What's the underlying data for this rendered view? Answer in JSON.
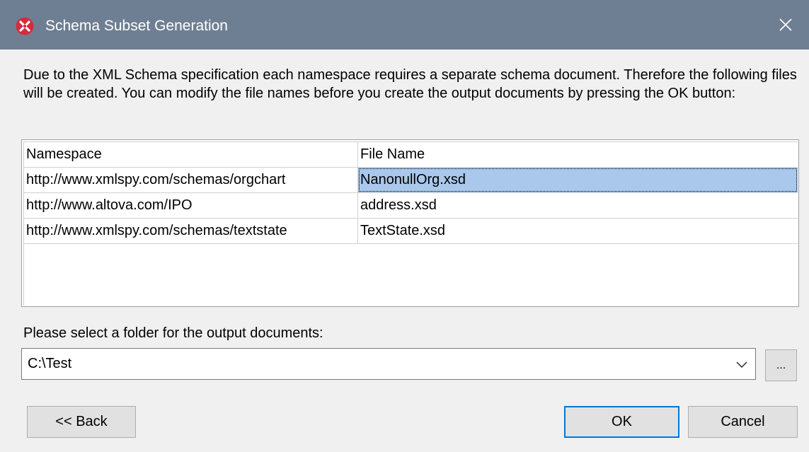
{
  "window": {
    "title": "Schema Subset Generation",
    "close_glyph": "✕"
  },
  "description": "Due to the XML Schema specification each namespace requires a separate schema document. Therefore the following files will be created. You can modify the file names before you create the output documents by pressing the OK button:",
  "grid": {
    "columns": [
      "Namespace",
      "File Name"
    ],
    "rows": [
      {
        "namespace": "http://www.xmlspy.com/schemas/orgchart",
        "file_name": "NanonullOrg.xsd"
      },
      {
        "namespace": "http://www.altova.com/IPO",
        "file_name": "address.xsd"
      },
      {
        "namespace": "http://www.xmlspy.com/schemas/textstate",
        "file_name": "TextState.xsd"
      }
    ]
  },
  "folder": {
    "label": "Please select a folder for the output documents:",
    "value": "C:\\Test",
    "browse_label": "..."
  },
  "buttons": {
    "back": "<< Back",
    "ok": "OK",
    "cancel": "Cancel"
  },
  "colors": {
    "titlebar": "#6f7f93",
    "selection": "#a9c8ec",
    "default_button_border": "#0078d7",
    "app_icon": "#d52b3c"
  },
  "icons": {
    "app": "altova-xmlspy-icon",
    "close": "close-icon",
    "dropdown": "chevron-down-icon"
  }
}
